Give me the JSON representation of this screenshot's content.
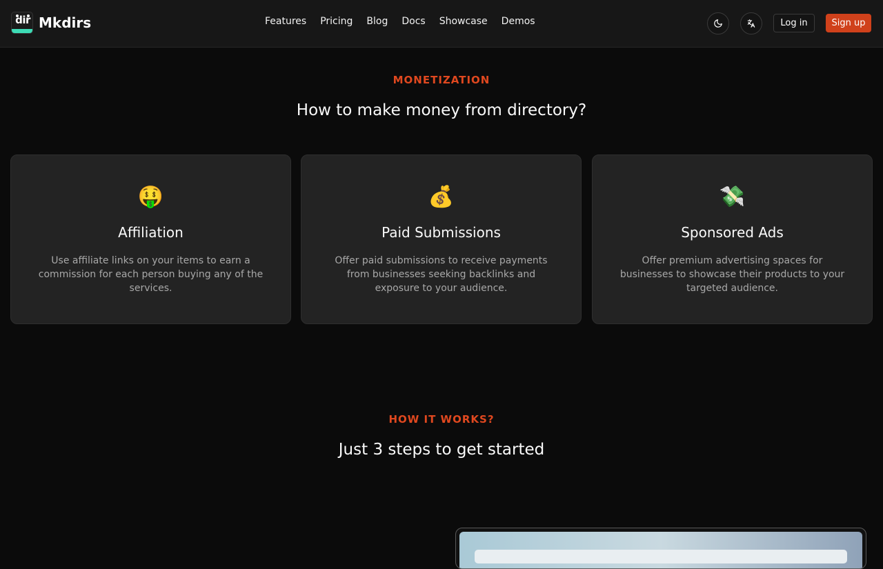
{
  "brand": {
    "name": "Mkdirs",
    "logo_text": "dir"
  },
  "nav": {
    "links": [
      "Features",
      "Pricing",
      "Blog",
      "Docs",
      "Showcase",
      "Demos"
    ],
    "theme_icon": "moon-icon",
    "language_icon": "translate-icon",
    "login_label": "Log in",
    "signup_label": "Sign up"
  },
  "colors": {
    "accent": "#d0411b",
    "label": "#e0481f",
    "background": "#0b0b0b",
    "card": "#232323"
  },
  "monetization": {
    "label": "MONETIZATION",
    "title": "How to make money from directory?",
    "cards": [
      {
        "emoji": "🤑",
        "icon": "money-mouth-face-icon",
        "title": "Affiliation",
        "description": "Use affiliate links on your items to earn a commission for each person buying any of the services."
      },
      {
        "emoji": "💰",
        "icon": "money-bag-icon",
        "title": "Paid Submissions",
        "description": "Offer paid submissions to receive payments from businesses seeking backlinks and exposure to your audience."
      },
      {
        "emoji": "💸",
        "icon": "money-with-wings-icon",
        "title": "Sponsored Ads",
        "description": "Offer premium advertising spaces for businesses to showcase their products to your targeted audience."
      }
    ]
  },
  "how_it_works": {
    "label": "HOW IT WORKS?",
    "title": "Just 3 steps to get started"
  }
}
